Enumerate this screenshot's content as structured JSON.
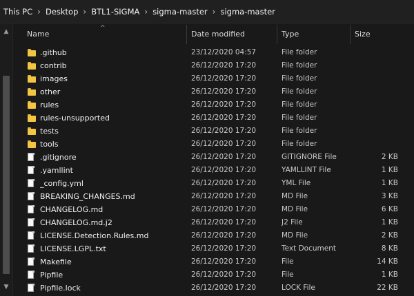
{
  "breadcrumb": [
    "This PC",
    "Desktop",
    "BTL1-SIGMA",
    "sigma-master",
    "sigma-master"
  ],
  "columns": {
    "name": "Name",
    "date": "Date modified",
    "type": "Type",
    "size": "Size"
  },
  "files": [
    {
      "name": ".github",
      "date": "23/12/2020 04:57",
      "type": "File folder",
      "size": "",
      "icon": "folder-icon"
    },
    {
      "name": "contrib",
      "date": "26/12/2020 17:20",
      "type": "File folder",
      "size": "",
      "icon": "folder-icon"
    },
    {
      "name": "images",
      "date": "26/12/2020 17:20",
      "type": "File folder",
      "size": "",
      "icon": "folder-icon"
    },
    {
      "name": "other",
      "date": "26/12/2020 17:20",
      "type": "File folder",
      "size": "",
      "icon": "folder-icon"
    },
    {
      "name": "rules",
      "date": "26/12/2020 17:20",
      "type": "File folder",
      "size": "",
      "icon": "folder-icon"
    },
    {
      "name": "rules-unsupported",
      "date": "26/12/2020 17:20",
      "type": "File folder",
      "size": "",
      "icon": "folder-icon"
    },
    {
      "name": "tests",
      "date": "26/12/2020 17:20",
      "type": "File folder",
      "size": "",
      "icon": "folder-icon"
    },
    {
      "name": "tools",
      "date": "26/12/2020 17:20",
      "type": "File folder",
      "size": "",
      "icon": "folder-icon"
    },
    {
      "name": ".gitignore",
      "date": "26/12/2020 17:20",
      "type": "GITIGNORE File",
      "size": "2 KB",
      "icon": "file-icon"
    },
    {
      "name": ".yamllint",
      "date": "26/12/2020 17:20",
      "type": "YAMLLINT File",
      "size": "1 KB",
      "icon": "file-icon"
    },
    {
      "name": "_config.yml",
      "date": "26/12/2020 17:20",
      "type": "YML File",
      "size": "1 KB",
      "icon": "file-icon"
    },
    {
      "name": "BREAKING_CHANGES.md",
      "date": "26/12/2020 17:20",
      "type": "MD File",
      "size": "3 KB",
      "icon": "file-icon"
    },
    {
      "name": "CHANGELOG.md",
      "date": "26/12/2020 17:20",
      "type": "MD File",
      "size": "6 KB",
      "icon": "file-icon"
    },
    {
      "name": "CHANGELOG.md.j2",
      "date": "26/12/2020 17:20",
      "type": "J2 File",
      "size": "1 KB",
      "icon": "file-icon"
    },
    {
      "name": "LICENSE.Detection.Rules.md",
      "date": "26/12/2020 17:20",
      "type": "MD File",
      "size": "2 KB",
      "icon": "file-icon"
    },
    {
      "name": "LICENSE.LGPL.txt",
      "date": "26/12/2020 17:20",
      "type": "Text Document",
      "size": "8 KB",
      "icon": "file-icon"
    },
    {
      "name": "Makefile",
      "date": "26/12/2020 17:20",
      "type": "File",
      "size": "14 KB",
      "icon": "file-icon"
    },
    {
      "name": "Pipfile",
      "date": "26/12/2020 17:20",
      "type": "File",
      "size": "1 KB",
      "icon": "file-icon"
    },
    {
      "name": "Pipfile.lock",
      "date": "26/12/2020 17:20",
      "type": "LOCK File",
      "size": "22 KB",
      "icon": "file-icon"
    }
  ]
}
